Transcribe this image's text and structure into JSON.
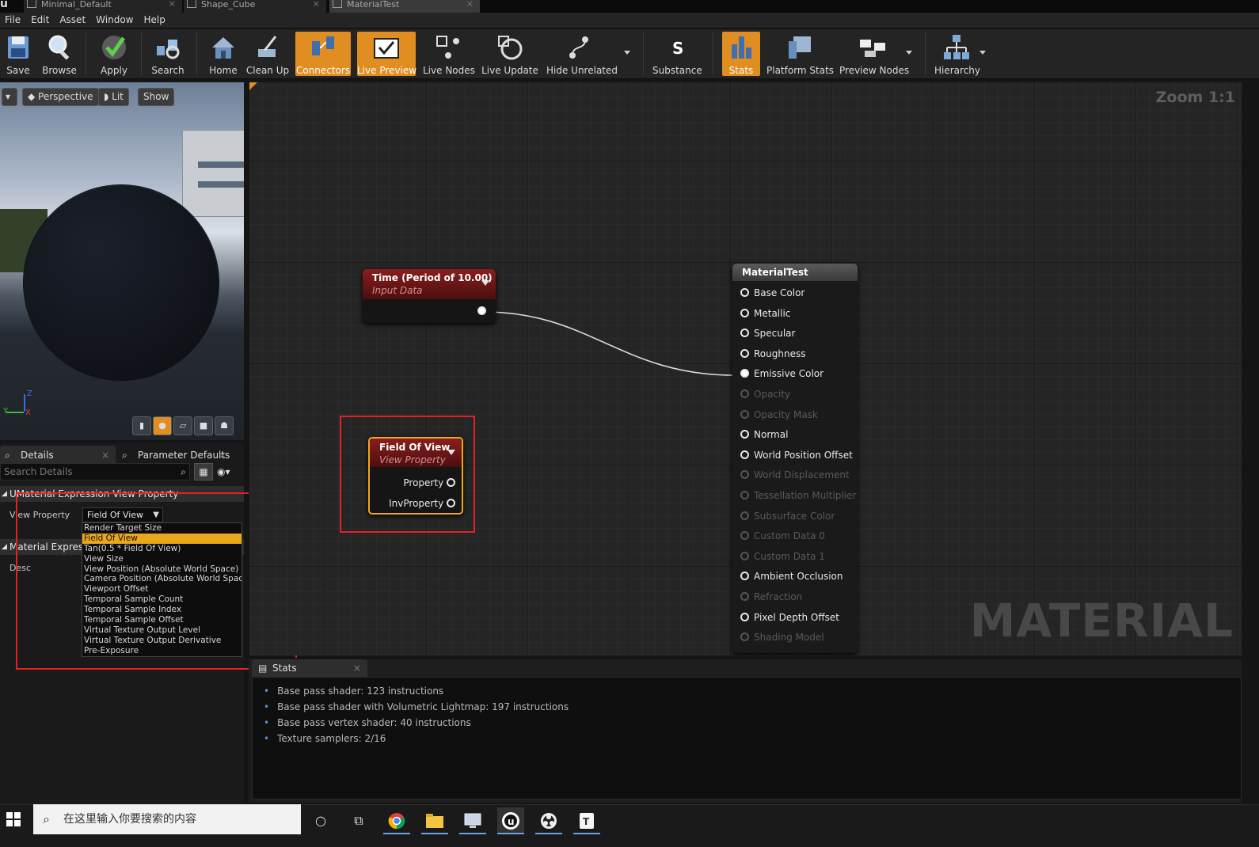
{
  "colors": {
    "accent": "#e08d21",
    "node_header": "#8a1e1e",
    "selection": "#e8a71c",
    "annotation": "#e32222",
    "wire": "#d8d8d8"
  },
  "doc_tabs": [
    {
      "label": "Minimal_Default",
      "icon": "level-icon"
    },
    {
      "label": "Shape_Cube",
      "icon": "mesh-icon"
    },
    {
      "label": "MaterialTest",
      "icon": "material-icon"
    }
  ],
  "menu": [
    "File",
    "Edit",
    "Asset",
    "Window",
    "Help"
  ],
  "toolbar": {
    "save": "Save",
    "browse": "Browse",
    "apply": "Apply",
    "search": "Search",
    "home": "Home",
    "clean_up": "Clean Up",
    "connectors": "Connectors",
    "live_preview": "Live Preview",
    "live_nodes": "Live Nodes",
    "live_update": "Live Update",
    "hide_unrelated": "Hide Unrelated",
    "substance": "Substance",
    "stats": "Stats",
    "platform_stats": "Platform Stats",
    "preview_nodes": "Preview Nodes",
    "hierarchy": "Hierarchy"
  },
  "viewport": {
    "perspective": "Perspective",
    "lit": "Lit",
    "show": "Show",
    "axis_y": "Y",
    "axis_z": "Z",
    "axis_x": "X"
  },
  "details": {
    "tab_details": "Details",
    "tab_params": "Parameter Defaults",
    "search_placeholder": "Search Details",
    "category1": "UMaterial Expression View Property",
    "view_property_label": "View Property",
    "view_property_value": "Field Of View",
    "options": [
      "Render Target Size",
      "Field Of View",
      "Tan(0.5 * Field Of View)",
      "View Size",
      "View Position (Absolute World Space)",
      "Camera Position (Absolute World Space)",
      "Viewport Offset",
      "Temporal Sample Count",
      "Temporal Sample Index",
      "Temporal Sample Offset",
      "Virtual Texture Output Level",
      "Virtual Texture Output Derivative",
      "Pre-Exposure"
    ],
    "category2": "Material Expression",
    "desc_label": "Desc"
  },
  "graph": {
    "zoom": "Zoom 1:1",
    "watermark": "MATERIAL",
    "time_node": {
      "title": "Time (Period of 10.00)",
      "subtitle": "Input Data"
    },
    "fov_node": {
      "title": "Field Of View",
      "subtitle": "View Property",
      "pin1": "Property",
      "pin2": "InvProperty"
    },
    "result_node": {
      "title": "MaterialTest",
      "pins": [
        {
          "label": "Base Color",
          "enabled": true,
          "connected": false
        },
        {
          "label": "Metallic",
          "enabled": true,
          "connected": false
        },
        {
          "label": "Specular",
          "enabled": true,
          "connected": false
        },
        {
          "label": "Roughness",
          "enabled": true,
          "connected": false
        },
        {
          "label": "Emissive Color",
          "enabled": true,
          "connected": true
        },
        {
          "label": "Opacity",
          "enabled": false,
          "connected": false
        },
        {
          "label": "Opacity Mask",
          "enabled": false,
          "connected": false
        },
        {
          "label": "Normal",
          "enabled": true,
          "connected": false
        },
        {
          "label": "World Position Offset",
          "enabled": true,
          "connected": false
        },
        {
          "label": "World Displacement",
          "enabled": false,
          "connected": false
        },
        {
          "label": "Tessellation Multiplier",
          "enabled": false,
          "connected": false
        },
        {
          "label": "Subsurface Color",
          "enabled": false,
          "connected": false
        },
        {
          "label": "Custom Data 0",
          "enabled": false,
          "connected": false
        },
        {
          "label": "Custom Data 1",
          "enabled": false,
          "connected": false
        },
        {
          "label": "Ambient Occlusion",
          "enabled": true,
          "connected": false
        },
        {
          "label": "Refraction",
          "enabled": false,
          "connected": false
        },
        {
          "label": "Pixel Depth Offset",
          "enabled": true,
          "connected": false
        },
        {
          "label": "Shading Model",
          "enabled": false,
          "connected": false
        }
      ]
    }
  },
  "stats": {
    "tab": "Stats",
    "lines": [
      "Base pass shader: 123 instructions",
      "Base pass shader with Volumetric Lightmap: 197 instructions",
      "Base pass vertex shader: 40 instructions",
      "Texture samplers: 2/16"
    ]
  },
  "taskbar": {
    "search_placeholder": "在这里输入你要搜索的内容",
    "apps": [
      "cortana-icon",
      "task-view-icon",
      "chrome-icon",
      "file-explorer-icon",
      "remote-desktop-icon",
      "unreal-engine-icon",
      "obs-icon",
      "typora-icon"
    ]
  }
}
